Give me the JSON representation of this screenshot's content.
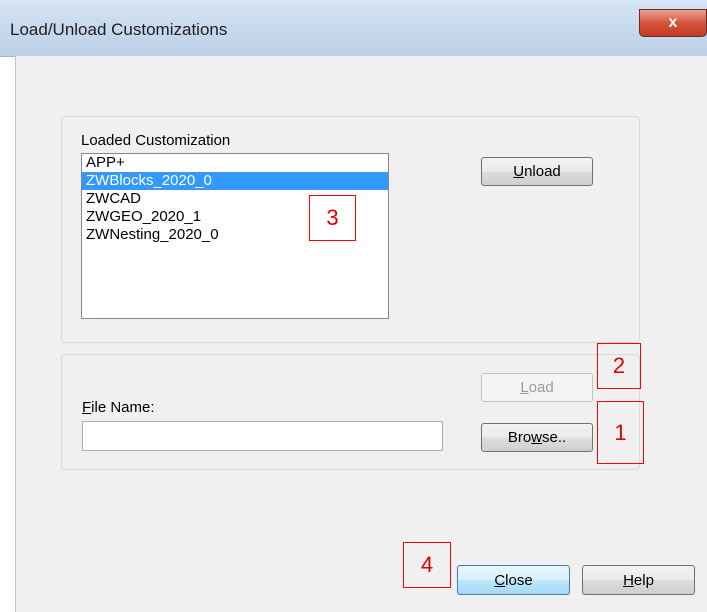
{
  "window": {
    "title": "Load/Unload Customizations",
    "close_glyph": "x"
  },
  "loaded": {
    "group_label": "Loaded Customization",
    "items": [
      "APP+",
      "ZWBlocks_2020_0",
      "ZWCAD",
      "ZWGEO_2020_1",
      "ZWNesting_2020_0"
    ],
    "selected_index": 1,
    "unload_prefix": "",
    "unload_mnemonic": "U",
    "unload_suffix": "nload"
  },
  "file": {
    "label_mnemonic": "F",
    "label_suffix": "ile Name:",
    "value": "",
    "load_mnemonic": "L",
    "load_suffix": "oad",
    "browse_prefix": "Bro",
    "browse_mnemonic": "w",
    "browse_suffix": "se.."
  },
  "footer": {
    "close_mnemonic": "C",
    "close_suffix": "lose",
    "help_mnemonic": "H",
    "help_suffix": "elp"
  },
  "annotations": [
    "1",
    "2",
    "3",
    "4"
  ],
  "colors": {
    "selection": "#3399ff",
    "annotation": "#ff0000",
    "close_button": "#c23b22"
  }
}
